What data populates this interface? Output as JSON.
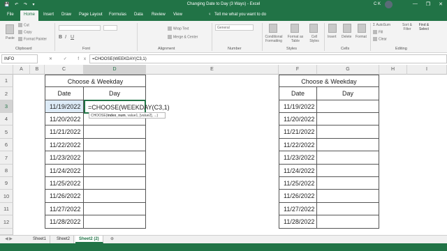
{
  "window": {
    "title": "Changing Date to Day (3 Ways)  -  Excel",
    "user": "C K",
    "controls": [
      "—",
      "❐",
      "✕"
    ],
    "quick_access": "💾 ↶ ↷ ▾"
  },
  "menu": {
    "tabs": [
      "File",
      "Home",
      "Insert",
      "Draw",
      "Page Layout",
      "Formulas",
      "Data",
      "Review",
      "View"
    ],
    "tell_me": "Tell me what you want to do"
  },
  "ribbon": {
    "clipboard": {
      "paste": "Paste",
      "cut": "Cut",
      "copy": "Copy",
      "format_painter": "Format Painter",
      "group": "Clipboard"
    },
    "font": {
      "group": "Font"
    },
    "alignment": {
      "wrap": "Wrap Text",
      "merge": "Merge & Center",
      "group": "Alignment"
    },
    "number": {
      "format": "General",
      "group": "Number"
    },
    "styles": {
      "conditional": "Conditional Formatting",
      "format_as": "Format as Table",
      "cell_styles": "Cell Styles",
      "group": "Styles"
    },
    "cells": {
      "insert": "Insert",
      "delete": "Delete",
      "format": "Format",
      "group": "Cells"
    },
    "editing": {
      "autosum": "AutoSum",
      "fill": "Fill",
      "clear": "Clear",
      "sort": "Sort & Filter",
      "find": "Find & Select",
      "group": "Editing"
    }
  },
  "formula_bar": {
    "name_box": "INFO",
    "icons": "✕ ✓ fx",
    "formula": "=CHOOSE(WEEKDAY(C3,1)"
  },
  "columns": [
    "A",
    "B",
    "C",
    "D",
    "E",
    "F",
    "G",
    "H",
    "I"
  ],
  "rows": [
    "1",
    "2",
    "3",
    "4",
    "5",
    "6",
    "7",
    "8",
    "9",
    "10",
    "11",
    "12"
  ],
  "table_left": {
    "title": "Choose & Weekday",
    "header_date": "Date",
    "header_day": "Day",
    "editing_text": "=CHOOSE(WEEKDAY(C3,1)",
    "dates": [
      "11/19/2022",
      "11/20/2022",
      "11/21/2022",
      "11/22/2022",
      "11/23/2022",
      "11/24/2022",
      "11/25/2022",
      "11/26/2022",
      "11/27/2022",
      "11/28/2022"
    ]
  },
  "table_right": {
    "title": "Choose & Weekday",
    "header_date": "Date",
    "header_day": "Day",
    "dates": [
      "11/19/2022",
      "11/20/2022",
      "11/21/2022",
      "11/22/2022",
      "11/23/2022",
      "11/24/2022",
      "11/25/2022",
      "11/26/2022",
      "11/27/2022",
      "11/28/2022"
    ]
  },
  "tooltip": {
    "fn": "CHOOSE(",
    "arg": "index_num",
    ", value1, [value2], ...)": ""
  },
  "tooltip_text": {
    "fn": "CHOOSE(",
    "bold": "index_num",
    "rest": ", value1, [value2], ...)"
  },
  "sheet_tabs": [
    "Sheet1",
    "Sheet2",
    "Sheet2 (2)"
  ],
  "colors": {
    "accent": "#217346"
  }
}
